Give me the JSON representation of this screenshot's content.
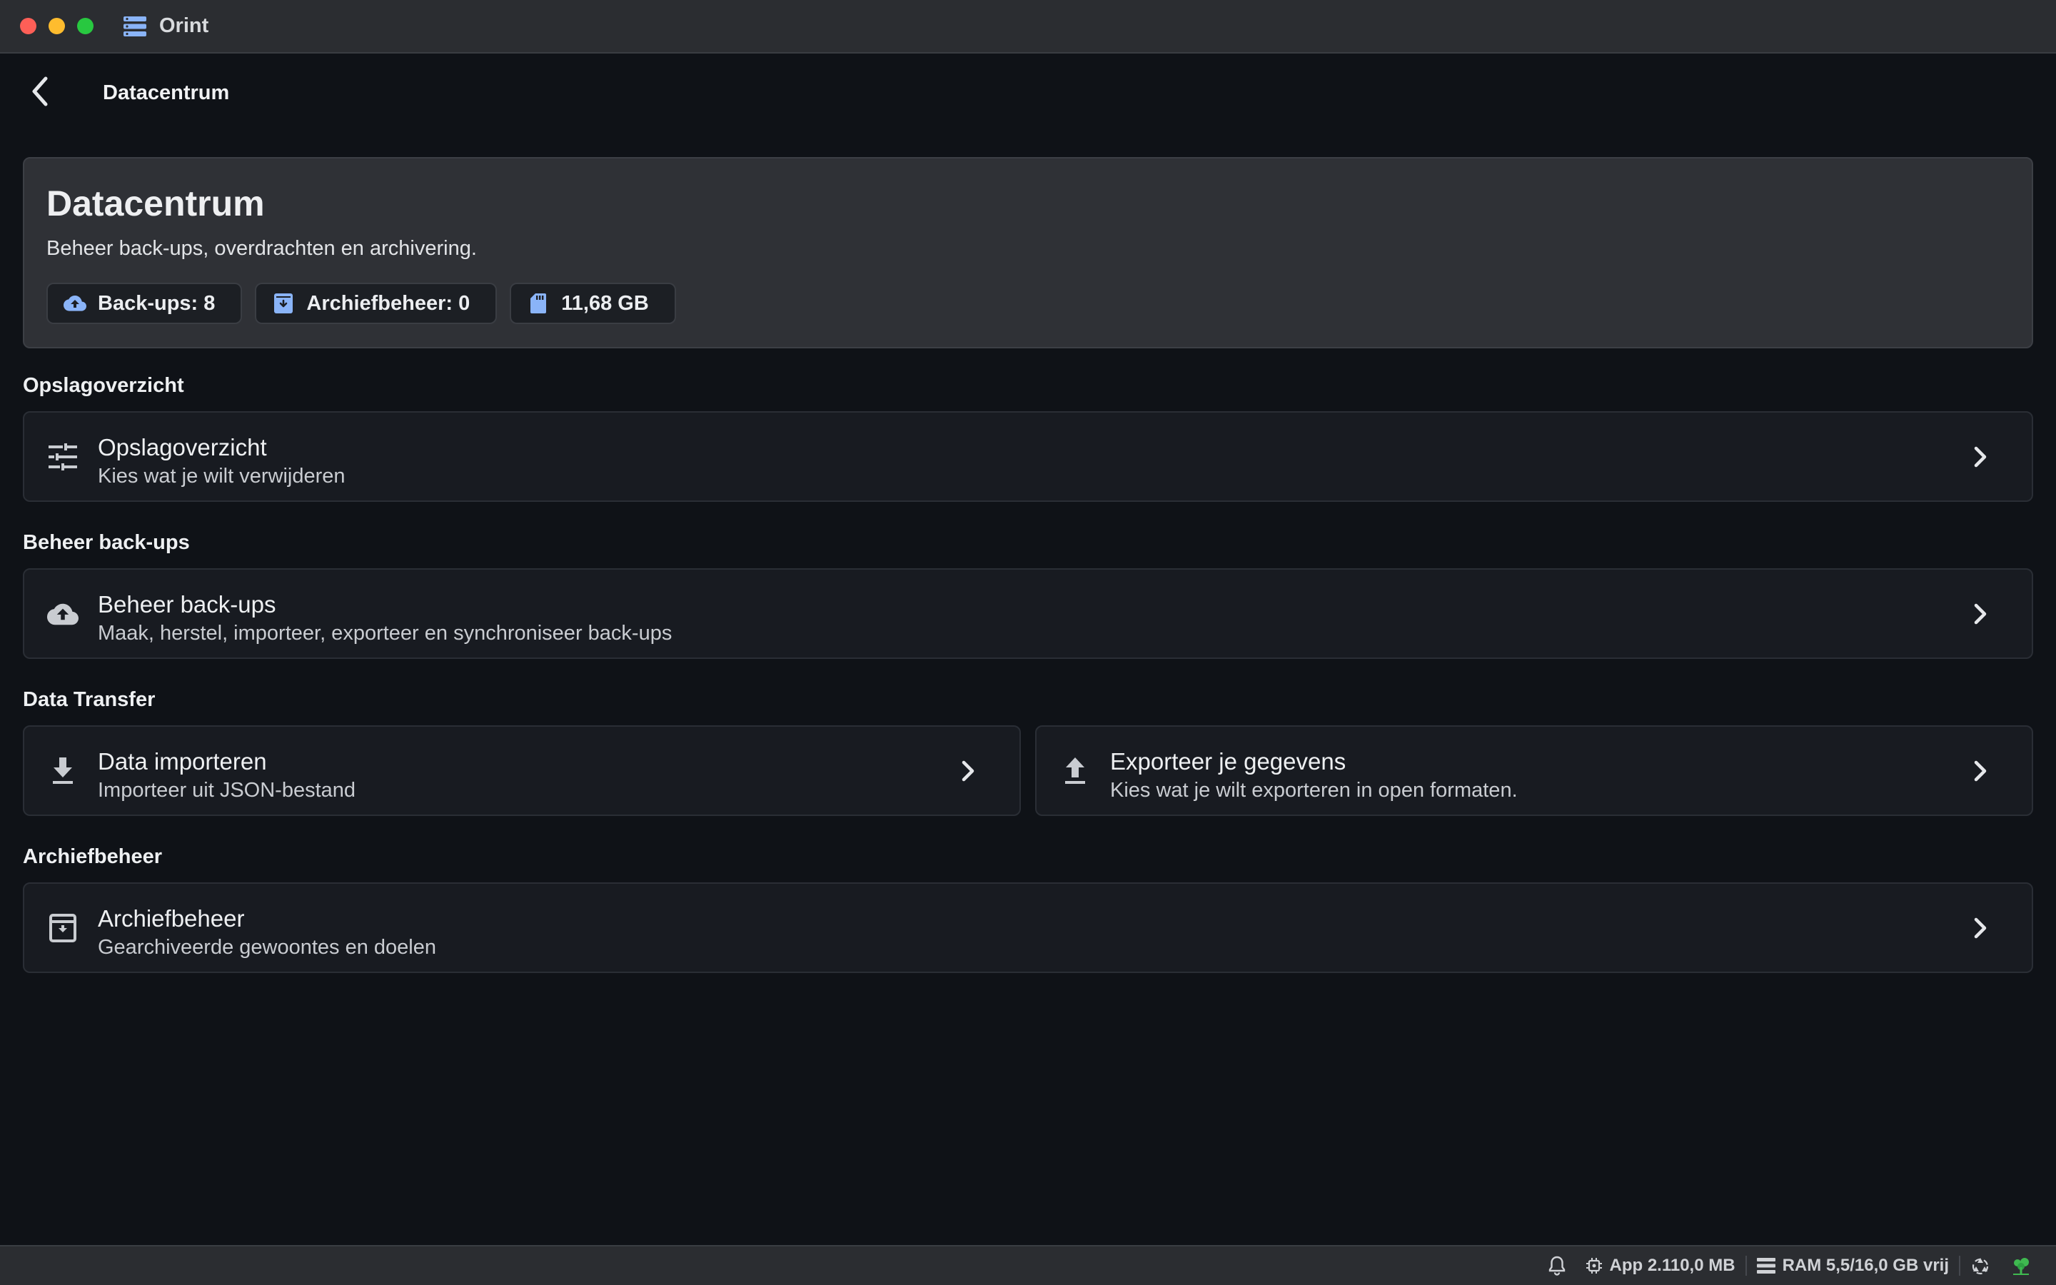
{
  "window": {
    "app_name": "Orint"
  },
  "header": {
    "title": "Datacentrum"
  },
  "hero": {
    "title": "Datacentrum",
    "subtitle": "Beheer back-ups, overdrachten en archivering.",
    "chips": [
      {
        "label": "Back-ups: 8",
        "icon": "cloud-upload-icon"
      },
      {
        "label": "Archiefbeheer: 0",
        "icon": "archive-box-icon"
      },
      {
        "label": "11,68 GB",
        "icon": "sd-card-icon"
      }
    ]
  },
  "sections": {
    "storage": {
      "label": "Opslagoverzicht",
      "item": {
        "title": "Opslagoverzicht",
        "subtitle": "Kies wat je wilt verwijderen",
        "icon": "tune-sliders-icon"
      }
    },
    "backups": {
      "label": "Beheer back-ups",
      "item": {
        "title": "Beheer back-ups",
        "subtitle": "Maak, herstel, importeer, exporteer en synchroniseer back-ups",
        "icon": "cloud-upload-icon"
      }
    },
    "transfer": {
      "label": "Data Transfer",
      "import": {
        "title": "Data importeren",
        "subtitle": "Importeer uit JSON-bestand",
        "icon": "download-icon"
      },
      "export": {
        "title": "Exporteer je gegevens",
        "subtitle": "Kies wat je wilt exporteren in open formaten.",
        "icon": "upload-icon"
      }
    },
    "archive": {
      "label": "Archiefbeheer",
      "item": {
        "title": "Archiefbeheer",
        "subtitle": "Gearchiveerde gewoontes en doelen",
        "icon": "archive-icon"
      }
    }
  },
  "statusbar": {
    "app_memory": "App 2.110,0 MB",
    "ram": "RAM 5,5/16,0 GB vrij"
  },
  "colors": {
    "background": "#0f1217",
    "card": "#181b21",
    "hero_card": "#2f3136",
    "accent_blue": "#8ab4f8",
    "status_green": "#3fb950"
  }
}
